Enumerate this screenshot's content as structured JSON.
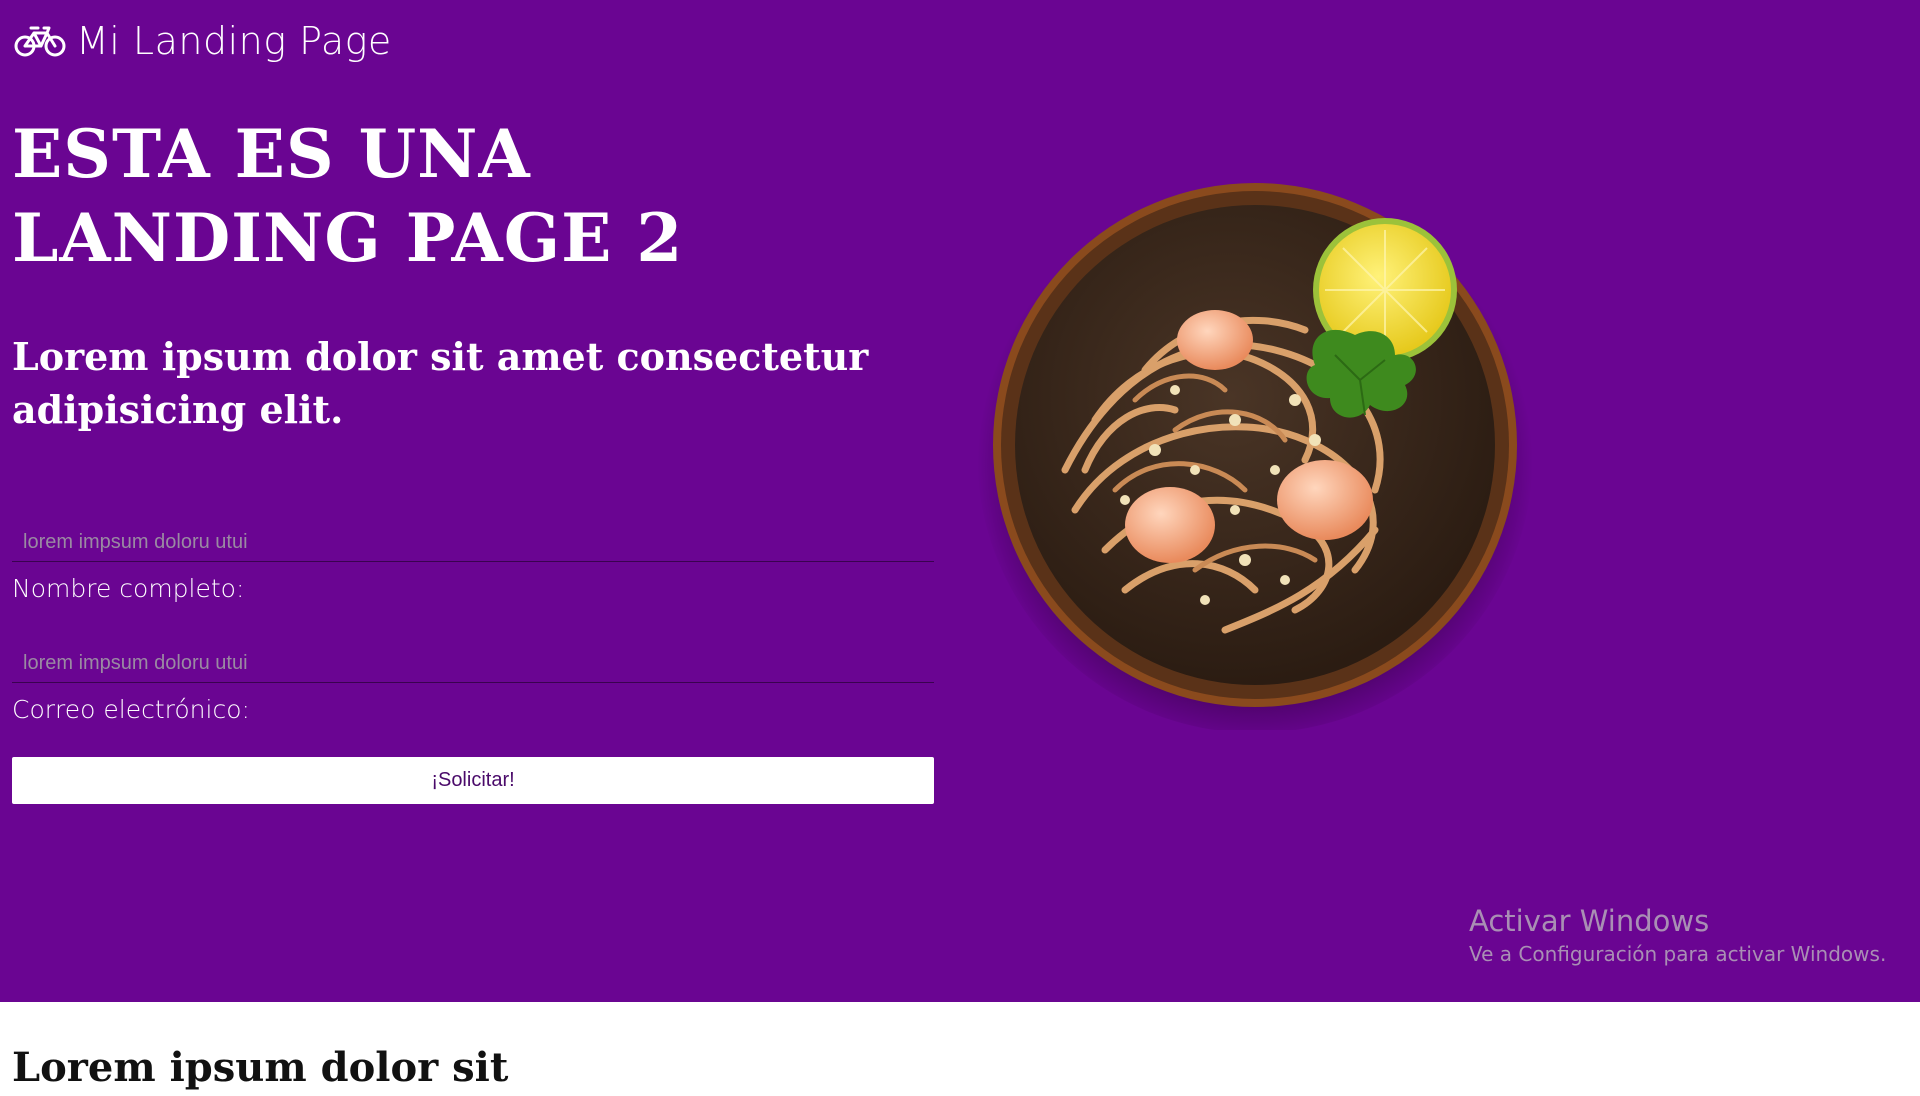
{
  "header": {
    "brand_text": "Mi Landing Page",
    "brand_icon": "bicycle-icon"
  },
  "hero": {
    "title": "ESTA ES UNA LANDING PAGE 2",
    "subtitle": "Lorem ipsum dolor sit amet consectetur adipisicing elit.",
    "background_color": "#6a0592",
    "image": "noodle-dish-photo"
  },
  "form": {
    "name_field": {
      "placeholder": "lorem impsum doloru utui",
      "value": "",
      "label": "Nombre completo:"
    },
    "email_field": {
      "placeholder": "lorem impsum doloru utui",
      "value": "",
      "label": "Correo electrónico:"
    },
    "submit_label": "¡Solicitar!"
  },
  "watermark": {
    "title": "Activar Windows",
    "subtitle": "Ve a Configuración para activar Windows."
  },
  "next_section": {
    "heading": "Lorem ipsum dolor sit"
  }
}
